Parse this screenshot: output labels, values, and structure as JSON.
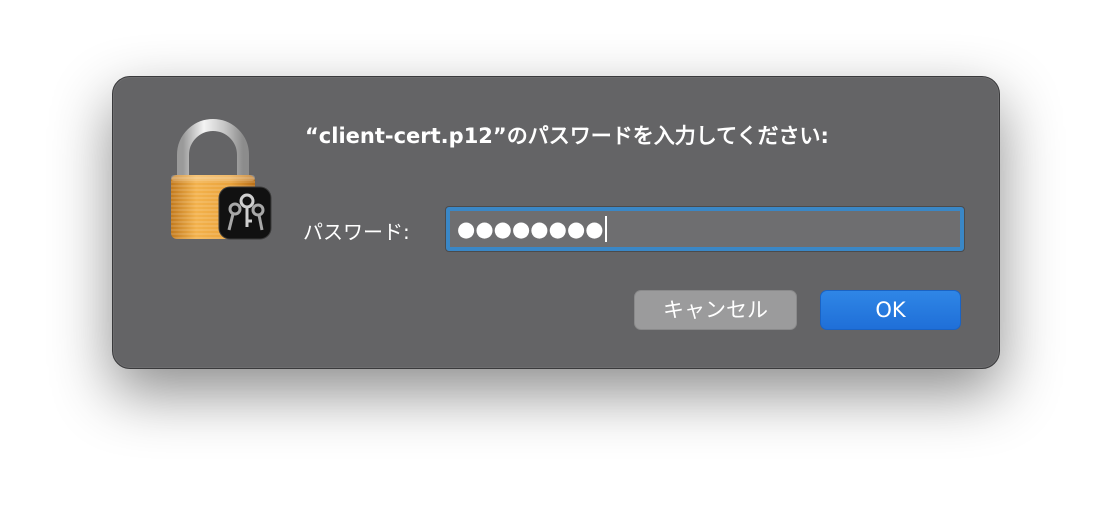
{
  "dialog": {
    "prompt": "“client-cert.p12”のパスワードを入力してください:",
    "password_label": "パスワード:",
    "password_value": "●●●●●●●●",
    "cancel_label": "キャンセル",
    "ok_label": "OK"
  },
  "icons": {
    "lock": "keychain-lock-icon",
    "keys": "keys-icon"
  },
  "colors": {
    "dialog_bg": "#646466",
    "accent": "#1f6fd8",
    "focus_ring": "#3a87c6",
    "lock_gold": "#e9a33f"
  }
}
